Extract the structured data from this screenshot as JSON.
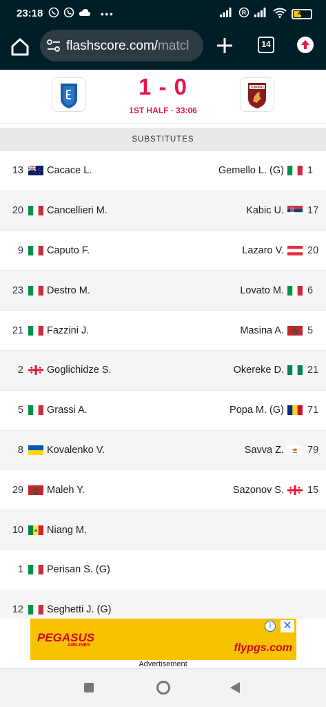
{
  "status_bar": {
    "time": "23:18",
    "left_icons": [
      "whatsapp-icon",
      "phone-icon",
      "cloud-icon",
      "more-dots-icon"
    ],
    "right_icons": [
      "signal-icon",
      "r-badge-icon",
      "signal-icon",
      "wifi-icon",
      "battery-icon"
    ],
    "battery": "45",
    "battery_level": 0.45
  },
  "browser": {
    "url_domain": "flashscore.com/",
    "url_rest": "matcl",
    "tab_count": "14"
  },
  "match": {
    "score": "1 - 0",
    "status": "1ST HALF · 33:06",
    "accent_color": "#e8144c"
  },
  "section_title": "SUBSTITUTES",
  "rows": [
    {
      "left": {
        "num": "13",
        "flag": "new-zealand",
        "name": "Cacace L."
      },
      "right": {
        "num": "1",
        "flag": "italy",
        "name": "Gemello L. (G)"
      }
    },
    {
      "left": {
        "num": "20",
        "flag": "italy",
        "name": "Cancellieri M."
      },
      "right": {
        "num": "17",
        "flag": "serbia",
        "name": "Kabic U."
      }
    },
    {
      "left": {
        "num": "9",
        "flag": "italy",
        "name": "Caputo F."
      },
      "right": {
        "num": "20",
        "flag": "austria",
        "name": "Lazaro V."
      }
    },
    {
      "left": {
        "num": "23",
        "flag": "italy",
        "name": "Destro M."
      },
      "right": {
        "num": "6",
        "flag": "italy",
        "name": "Lovato M."
      }
    },
    {
      "left": {
        "num": "21",
        "flag": "italy",
        "name": "Fazzini J."
      },
      "right": {
        "num": "5",
        "flag": "morocco",
        "name": "Masina A."
      }
    },
    {
      "left": {
        "num": "2",
        "flag": "georgia",
        "name": "Goglichidze S."
      },
      "right": {
        "num": "21",
        "flag": "nigeria",
        "name": "Okereke D."
      }
    },
    {
      "left": {
        "num": "5",
        "flag": "italy",
        "name": "Grassi A."
      },
      "right": {
        "num": "71",
        "flag": "romania",
        "name": "Popa M. (G)"
      }
    },
    {
      "left": {
        "num": "8",
        "flag": "ukraine",
        "name": "Kovalenko V."
      },
      "right": {
        "num": "79",
        "flag": "cyprus",
        "name": "Savva Z."
      }
    },
    {
      "left": {
        "num": "29",
        "flag": "morocco",
        "name": "Maleh Y."
      },
      "right": {
        "num": "15",
        "flag": "georgia",
        "name": "Sazonov S."
      }
    },
    {
      "left": {
        "num": "10",
        "flag": "senegal",
        "name": "Niang M."
      },
      "right": null
    },
    {
      "left": {
        "num": "1",
        "flag": "italy",
        "name": "Perisan S. (G)"
      },
      "right": null
    },
    {
      "left": {
        "num": "12",
        "flag": "italy",
        "name": "Seghetti J. (G)"
      },
      "right": null
    }
  ],
  "ad": {
    "brand": "PEGASUS",
    "brand_sub": "AIRLINES",
    "site": "flypgs.com",
    "label": "Advertisement",
    "bg_color": "#f8c200"
  }
}
